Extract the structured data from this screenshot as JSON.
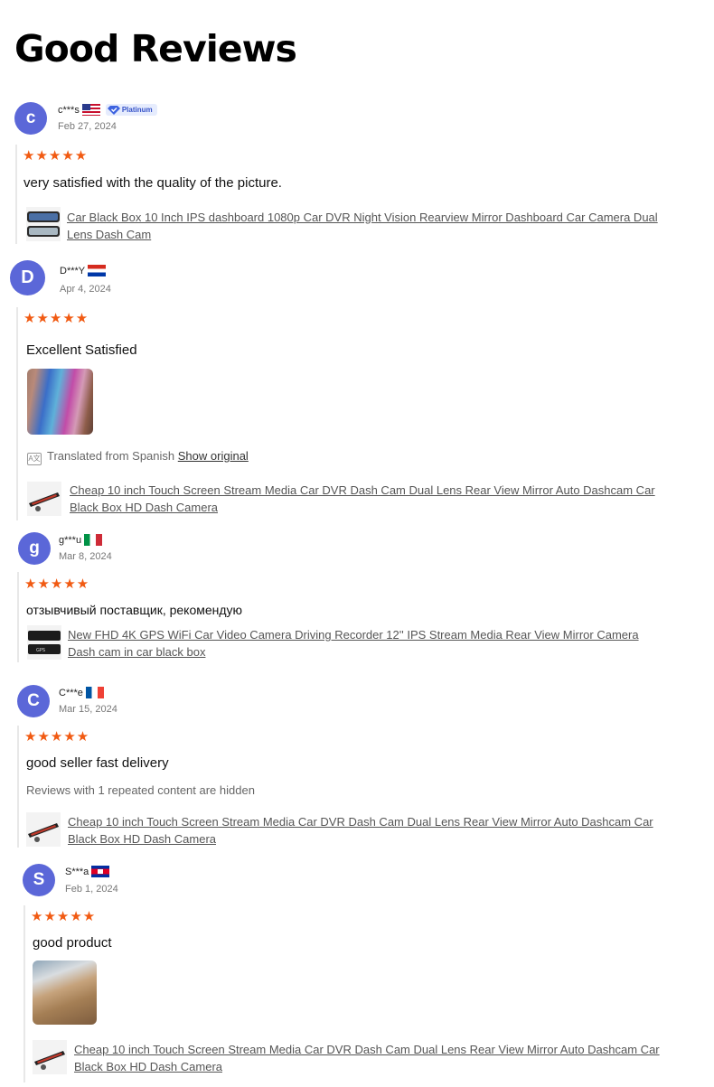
{
  "page": {
    "title": "Good Reviews"
  },
  "colors": {
    "accent_star": "#f15a12",
    "avatar_bg": "#5b67d8"
  },
  "reviews": [
    {
      "initial": "c",
      "user": "c***s",
      "flag": "us-flag",
      "badge": "Platinum",
      "date": "Feb 27, 2024",
      "stars": "★★★★★",
      "text": "very satisfied with the quality of the picture.",
      "product": "Car Black Box 10 Inch IPS dashboard 1080p Car DVR Night Vision Rearview Mirror Dashboard Car Camera Dual Lens Dash Cam"
    },
    {
      "initial": "D",
      "user": "D***Y",
      "flag": "paraguay-flag",
      "date": "Apr 4, 2024",
      "stars": "★★★★★",
      "text": "Excellent Satisfied",
      "translated_prefix": "Translated from Spanish",
      "translated_link": "Show original",
      "product": "Cheap 10 inch Touch Screen Stream Media Car DVR Dash Cam Dual Lens Rear View Mirror Auto Dashcam Car Black Box HD Dash Camera"
    },
    {
      "initial": "g",
      "user": "g***u",
      "flag": "italy-flag",
      "date": "Mar 8, 2024",
      "stars": "★★★★★",
      "text": "отзывчивый поставщик, рекомендую",
      "product": "New FHD 4K GPS WiFi Car Video Camera Driving Recorder 12'' IPS Stream Media Rear View Mirror Camera Dash cam in car black box"
    },
    {
      "initial": "C",
      "user": "C***e",
      "flag": "france-flag",
      "date": "Mar 15, 2024",
      "stars": "★★★★★",
      "text": "good seller fast delivery",
      "note": "Reviews with 1 repeated content are hidden",
      "product": "Cheap 10 inch Touch Screen Stream Media Car DVR Dash Cam Dual Lens Rear View Mirror Auto Dashcam Car Black Box HD Dash Camera"
    },
    {
      "initial": "S",
      "user": "S***a",
      "flag": "cambodia-flag",
      "date": "Feb 1, 2024",
      "stars": "★★★★★",
      "text": "good product",
      "product": "Cheap 10 inch Touch Screen Stream Media Car DVR Dash Cam Dual Lens Rear View Mirror Auto Dashcam Car Black Box HD Dash Camera"
    }
  ]
}
